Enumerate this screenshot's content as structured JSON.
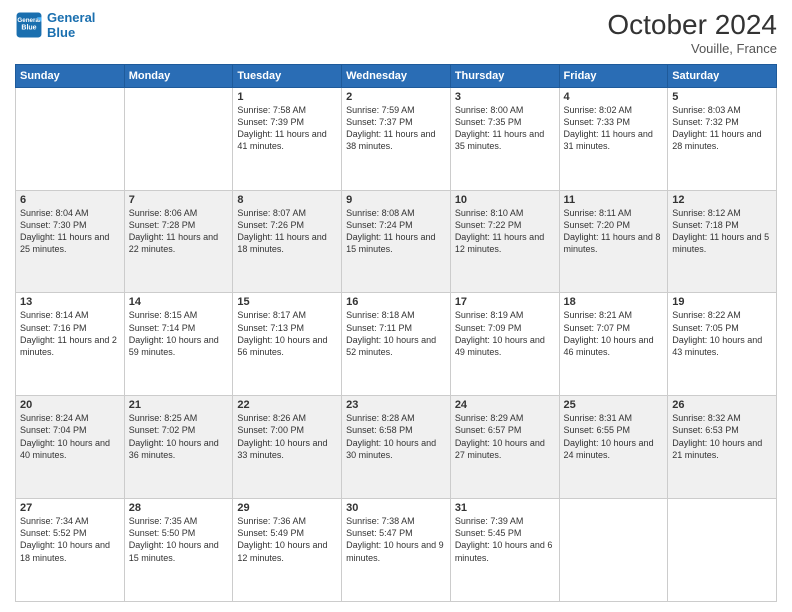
{
  "header": {
    "logo_line1": "General",
    "logo_line2": "Blue",
    "month": "October 2024",
    "location": "Vouille, France"
  },
  "days_of_week": [
    "Sunday",
    "Monday",
    "Tuesday",
    "Wednesday",
    "Thursday",
    "Friday",
    "Saturday"
  ],
  "weeks": [
    [
      {
        "day": "",
        "sunrise": "",
        "sunset": "",
        "daylight": ""
      },
      {
        "day": "",
        "sunrise": "",
        "sunset": "",
        "daylight": ""
      },
      {
        "day": "1",
        "sunrise": "Sunrise: 7:58 AM",
        "sunset": "Sunset: 7:39 PM",
        "daylight": "Daylight: 11 hours and 41 minutes."
      },
      {
        "day": "2",
        "sunrise": "Sunrise: 7:59 AM",
        "sunset": "Sunset: 7:37 PM",
        "daylight": "Daylight: 11 hours and 38 minutes."
      },
      {
        "day": "3",
        "sunrise": "Sunrise: 8:00 AM",
        "sunset": "Sunset: 7:35 PM",
        "daylight": "Daylight: 11 hours and 35 minutes."
      },
      {
        "day": "4",
        "sunrise": "Sunrise: 8:02 AM",
        "sunset": "Sunset: 7:33 PM",
        "daylight": "Daylight: 11 hours and 31 minutes."
      },
      {
        "day": "5",
        "sunrise": "Sunrise: 8:03 AM",
        "sunset": "Sunset: 7:32 PM",
        "daylight": "Daylight: 11 hours and 28 minutes."
      }
    ],
    [
      {
        "day": "6",
        "sunrise": "Sunrise: 8:04 AM",
        "sunset": "Sunset: 7:30 PM",
        "daylight": "Daylight: 11 hours and 25 minutes."
      },
      {
        "day": "7",
        "sunrise": "Sunrise: 8:06 AM",
        "sunset": "Sunset: 7:28 PM",
        "daylight": "Daylight: 11 hours and 22 minutes."
      },
      {
        "day": "8",
        "sunrise": "Sunrise: 8:07 AM",
        "sunset": "Sunset: 7:26 PM",
        "daylight": "Daylight: 11 hours and 18 minutes."
      },
      {
        "day": "9",
        "sunrise": "Sunrise: 8:08 AM",
        "sunset": "Sunset: 7:24 PM",
        "daylight": "Daylight: 11 hours and 15 minutes."
      },
      {
        "day": "10",
        "sunrise": "Sunrise: 8:10 AM",
        "sunset": "Sunset: 7:22 PM",
        "daylight": "Daylight: 11 hours and 12 minutes."
      },
      {
        "day": "11",
        "sunrise": "Sunrise: 8:11 AM",
        "sunset": "Sunset: 7:20 PM",
        "daylight": "Daylight: 11 hours and 8 minutes."
      },
      {
        "day": "12",
        "sunrise": "Sunrise: 8:12 AM",
        "sunset": "Sunset: 7:18 PM",
        "daylight": "Daylight: 11 hours and 5 minutes."
      }
    ],
    [
      {
        "day": "13",
        "sunrise": "Sunrise: 8:14 AM",
        "sunset": "Sunset: 7:16 PM",
        "daylight": "Daylight: 11 hours and 2 minutes."
      },
      {
        "day": "14",
        "sunrise": "Sunrise: 8:15 AM",
        "sunset": "Sunset: 7:14 PM",
        "daylight": "Daylight: 10 hours and 59 minutes."
      },
      {
        "day": "15",
        "sunrise": "Sunrise: 8:17 AM",
        "sunset": "Sunset: 7:13 PM",
        "daylight": "Daylight: 10 hours and 56 minutes."
      },
      {
        "day": "16",
        "sunrise": "Sunrise: 8:18 AM",
        "sunset": "Sunset: 7:11 PM",
        "daylight": "Daylight: 10 hours and 52 minutes."
      },
      {
        "day": "17",
        "sunrise": "Sunrise: 8:19 AM",
        "sunset": "Sunset: 7:09 PM",
        "daylight": "Daylight: 10 hours and 49 minutes."
      },
      {
        "day": "18",
        "sunrise": "Sunrise: 8:21 AM",
        "sunset": "Sunset: 7:07 PM",
        "daylight": "Daylight: 10 hours and 46 minutes."
      },
      {
        "day": "19",
        "sunrise": "Sunrise: 8:22 AM",
        "sunset": "Sunset: 7:05 PM",
        "daylight": "Daylight: 10 hours and 43 minutes."
      }
    ],
    [
      {
        "day": "20",
        "sunrise": "Sunrise: 8:24 AM",
        "sunset": "Sunset: 7:04 PM",
        "daylight": "Daylight: 10 hours and 40 minutes."
      },
      {
        "day": "21",
        "sunrise": "Sunrise: 8:25 AM",
        "sunset": "Sunset: 7:02 PM",
        "daylight": "Daylight: 10 hours and 36 minutes."
      },
      {
        "day": "22",
        "sunrise": "Sunrise: 8:26 AM",
        "sunset": "Sunset: 7:00 PM",
        "daylight": "Daylight: 10 hours and 33 minutes."
      },
      {
        "day": "23",
        "sunrise": "Sunrise: 8:28 AM",
        "sunset": "Sunset: 6:58 PM",
        "daylight": "Daylight: 10 hours and 30 minutes."
      },
      {
        "day": "24",
        "sunrise": "Sunrise: 8:29 AM",
        "sunset": "Sunset: 6:57 PM",
        "daylight": "Daylight: 10 hours and 27 minutes."
      },
      {
        "day": "25",
        "sunrise": "Sunrise: 8:31 AM",
        "sunset": "Sunset: 6:55 PM",
        "daylight": "Daylight: 10 hours and 24 minutes."
      },
      {
        "day": "26",
        "sunrise": "Sunrise: 8:32 AM",
        "sunset": "Sunset: 6:53 PM",
        "daylight": "Daylight: 10 hours and 21 minutes."
      }
    ],
    [
      {
        "day": "27",
        "sunrise": "Sunrise: 7:34 AM",
        "sunset": "Sunset: 5:52 PM",
        "daylight": "Daylight: 10 hours and 18 minutes."
      },
      {
        "day": "28",
        "sunrise": "Sunrise: 7:35 AM",
        "sunset": "Sunset: 5:50 PM",
        "daylight": "Daylight: 10 hours and 15 minutes."
      },
      {
        "day": "29",
        "sunrise": "Sunrise: 7:36 AM",
        "sunset": "Sunset: 5:49 PM",
        "daylight": "Daylight: 10 hours and 12 minutes."
      },
      {
        "day": "30",
        "sunrise": "Sunrise: 7:38 AM",
        "sunset": "Sunset: 5:47 PM",
        "daylight": "Daylight: 10 hours and 9 minutes."
      },
      {
        "day": "31",
        "sunrise": "Sunrise: 7:39 AM",
        "sunset": "Sunset: 5:45 PM",
        "daylight": "Daylight: 10 hours and 6 minutes."
      },
      {
        "day": "",
        "sunrise": "",
        "sunset": "",
        "daylight": ""
      },
      {
        "day": "",
        "sunrise": "",
        "sunset": "",
        "daylight": ""
      }
    ]
  ]
}
